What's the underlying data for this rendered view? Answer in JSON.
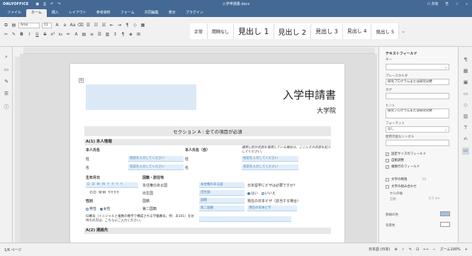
{
  "app": {
    "brand": "ONLYOFFICE",
    "doc_title": "入学申請書.docx",
    "share_label": "共有"
  },
  "menu": {
    "tabs": [
      "ファイル",
      "ホーム",
      "挿入",
      "レイアウト",
      "参考資料",
      "フォーム",
      "共同編集",
      "表示",
      "プラグイン"
    ],
    "active": "ホーム"
  },
  "toolbar": {
    "font_name": "Arial",
    "font_size": "11",
    "styles": [
      "正常",
      "間隔なし",
      "見出し 1",
      "見出し 2",
      "見出し 3",
      "見出し 4",
      "見出し 5"
    ]
  },
  "document": {
    "title": "入学申請書",
    "subtitle": "大学院",
    "section_a": "セクション A : 全ての項目が必須",
    "a1_header": "A(1) 本人情報",
    "name_label": "本人氏名",
    "name_local_label": "本人氏名（自）",
    "note_name": "通常に別の名前を使用している場合は、ここにその名前を記入してください。",
    "surname_label": "姓",
    "given_label": "名",
    "surname_ph": "姓前を入力してください",
    "given_ph": "名前を入力してください",
    "surname_ph2": "姓前を入力してください",
    "given_ph2": "名前を入力してください",
    "dob_label": "生年月日",
    "dob_placeholder": "D D M M Y Y Y Y",
    "dob_format": "DD MM YYYY",
    "nationality_label": "国籍・居住地",
    "permanent_country": "永住権のある国",
    "birth_country": "出生国",
    "nationality": "国籍",
    "second_nationality": "第二国籍",
    "ph_permanent": "永住権のある国",
    "ph_birth": "出生国",
    "ph_nat": "国籍",
    "ph_second": "第二国籍",
    "visa_q": "日本留学にビザは必要ですか？",
    "yes": "はい",
    "no": "いいえ",
    "current_visa_label": "現在の日本ビザ（該当する場合）",
    "current_visa_ph": "現在の日本ビザ",
    "gender_label": "性別",
    "male": "男性",
    "female": "女性",
    "id_note": "ID番号（イニシャルと複数の数字で構成される学籍番号。例：あ101）をお持ちの方は、こちらにご入力ください。",
    "a2_header": "A(2) 連絡先"
  },
  "right_panel": {
    "title": "テキストフィールド",
    "key_label": "キー",
    "placeholder_label": "プレースホルダ",
    "placeholder_value": "研究プログラムまたは研究分野",
    "tag_label": "タグ",
    "hint_label": "ヒント",
    "hint_value": "研究プログラムまたは研究分野",
    "format_label": "フォーマット",
    "format_value": "なし",
    "allowed_symbols_label": "使用可能なシンボル",
    "fixed_size": "固定サイズのフィールド",
    "autofit": "自動調整",
    "required": "複数行のフィールド",
    "char_limit": "文字の制限",
    "char_limit_value": "10",
    "comb": "文字の組み合わせ",
    "cell_width": "セルの幅",
    "cell_width_value": "自動",
    "cell_width_unit": "0.5 cm",
    "border_color": "罫線の色",
    "bg_color": "背景色"
  },
  "status": {
    "page": "1/6 ページ",
    "language": "日本語 (日本)",
    "zoom": "ズーム100%"
  }
}
